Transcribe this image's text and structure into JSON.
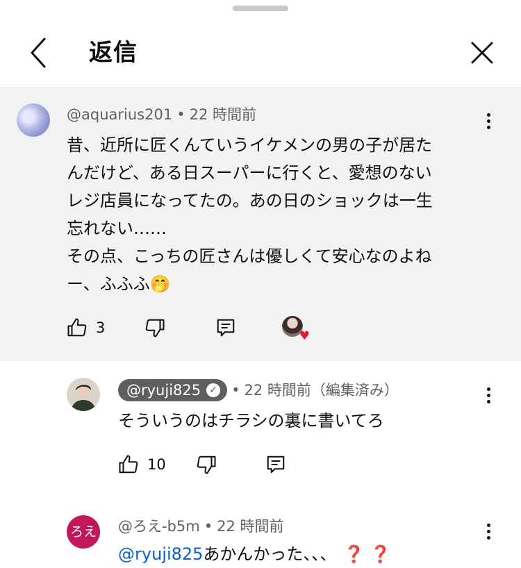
{
  "header": {
    "title": "返信"
  },
  "parent": {
    "author": "@aquarius201",
    "time": "22 時間前",
    "lines": [
      "昔、近所に匠くんていうイケメンの男の子が居た",
      "んだけど、ある日スーパーに行くと、愛想のない",
      "レジ店員になってたの。あの日のショックは一生",
      "忘れない……",
      "その点、こっちの匠さんは優しくて安心なのよね",
      "ー、ふふふ"
    ],
    "emoji": "🤭",
    "likes": "3"
  },
  "reply1": {
    "author": "@ryuji825",
    "time": "22 時間前（編集済み）",
    "text": "そういうのはチラシの裏に書いてろ",
    "likes": "10"
  },
  "reply2": {
    "avatar_text": "ろえ",
    "author": "@ろえ-b5m",
    "time": "22 時間前",
    "mention": "@ryuji825",
    "text": "あかんかった、、、",
    "qmarks": "❓ ❓"
  },
  "colors": {
    "parent_bg": "#f2f2f2",
    "chip_bg": "#5f5f5f",
    "mention": "#065fd4",
    "roe_avatar": "#c2185b",
    "heart": "#e8192c"
  },
  "icons": [
    "back-arrow-icon",
    "close-icon",
    "more-vert-icon",
    "thumb-up-icon",
    "thumb-down-icon",
    "reply-icon",
    "heart-icon",
    "verified-check-icon"
  ]
}
